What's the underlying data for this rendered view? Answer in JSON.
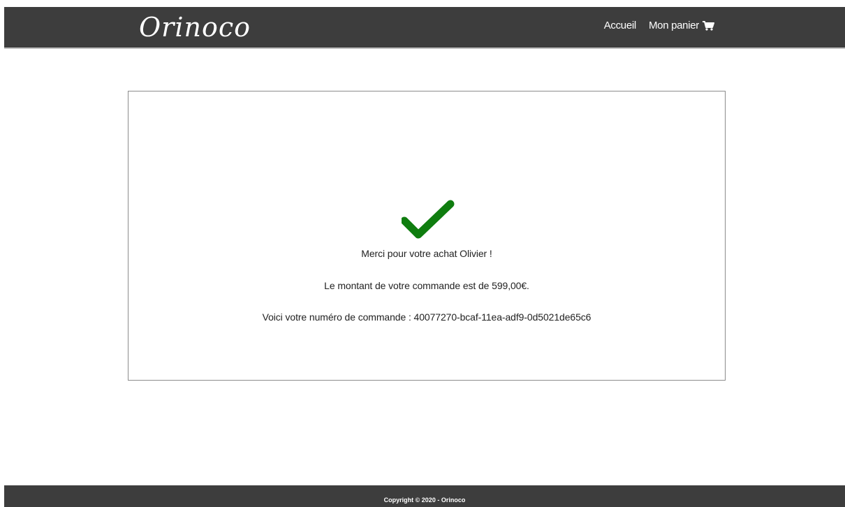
{
  "header": {
    "brand": "Orinoco",
    "nav": {
      "home": "Accueil",
      "cart": "Mon panier"
    },
    "icons": {
      "cart": "cart-icon"
    }
  },
  "confirmation": {
    "icon": "check-icon",
    "icon_color": "#0f7d0f",
    "thanks": "Merci pour votre achat Olivier !",
    "amount": "Le montant de votre commande est de 599,00€.",
    "order_number": "Voici votre numéro de commande : 40077270-bcaf-11ea-adf9-0d5021de65c6"
  },
  "footer": {
    "copyright": "Copyright © 2020 - Orinoco"
  },
  "colors": {
    "header_bg": "#3d3d3d",
    "footer_bg": "#3d3d3d",
    "text": "#222222"
  }
}
